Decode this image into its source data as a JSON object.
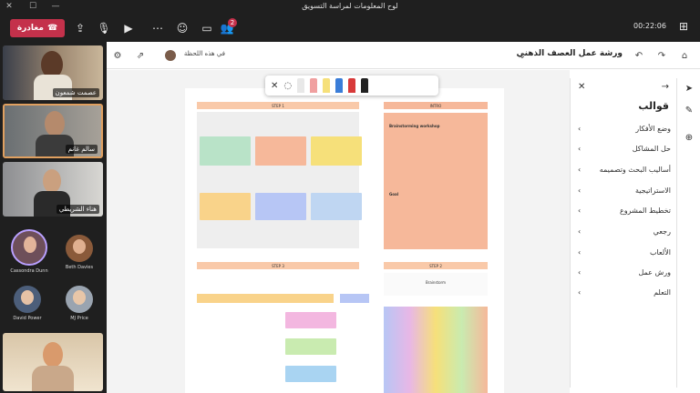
{
  "window": {
    "title": "لوح المعلومات لمراسة التسويق"
  },
  "toolbar": {
    "leave_label": "مغادرة",
    "timer": "00:22:06",
    "chat_badge": "2"
  },
  "participants": [
    {
      "name": "عصمت شمعون"
    },
    {
      "name": "سالم غانم"
    },
    {
      "name": "هناء الشريطي"
    },
    {
      "name": "Cassondra Dunn"
    },
    {
      "name": "Beth Davies"
    },
    {
      "name": "David Power"
    },
    {
      "name": "MJ Price"
    }
  ],
  "whiteboard": {
    "title": "ورشة عمل العصف الذهني",
    "subtitle": "في هذه اللحظة"
  },
  "board": {
    "step1": "STEP 1",
    "step2": "STEP 2",
    "step3": "STEP 3",
    "intro": "INTRO",
    "intro_heading": "Brainstorming workshop",
    "goal_label": "Goal",
    "brainstorm": "Brainstorm"
  },
  "panel": {
    "heading": "قوالب",
    "items": [
      "وضع الأفكار",
      "حل المشاكل",
      "أساليب البحث وتصميمه",
      "الاستراتيجية",
      "تخطيط المشروع",
      "رجعي",
      "الألعاب",
      "ورش عمل",
      "التعلم"
    ]
  },
  "colors": {
    "accent": "#c4314b",
    "intro": "#f6b89a",
    "step": "#f9c9a9"
  }
}
